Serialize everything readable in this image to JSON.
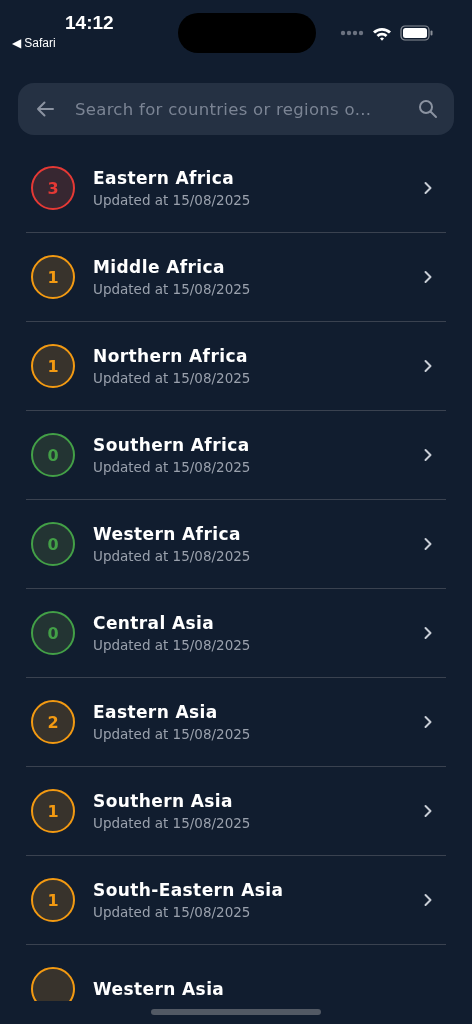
{
  "status_bar": {
    "time": "14:12",
    "back_app": "◀ Safari"
  },
  "search": {
    "placeholder": "Search for countries or regions o..."
  },
  "regions": [
    {
      "name": "Eastern Africa",
      "updated": "Updated at 15/08/2025",
      "count": "3",
      "color": "#e53935"
    },
    {
      "name": "Middle Africa",
      "updated": "Updated at 15/08/2025",
      "count": "1",
      "color": "#f39a12"
    },
    {
      "name": "Northern Africa",
      "updated": "Updated at 15/08/2025",
      "count": "1",
      "color": "#f39a12"
    },
    {
      "name": "Southern Africa",
      "updated": "Updated at 15/08/2025",
      "count": "0",
      "color": "#43a047"
    },
    {
      "name": "Western Africa",
      "updated": "Updated at 15/08/2025",
      "count": "0",
      "color": "#43a047"
    },
    {
      "name": "Central Asia",
      "updated": "Updated at 15/08/2025",
      "count": "0",
      "color": "#43a047"
    },
    {
      "name": "Eastern Asia",
      "updated": "Updated at 15/08/2025",
      "count": "2",
      "color": "#f39a12"
    },
    {
      "name": "Southern Asia",
      "updated": "Updated at 15/08/2025",
      "count": "1",
      "color": "#f39a12"
    },
    {
      "name": "South-Eastern Asia",
      "updated": "Updated at 15/08/2025",
      "count": "1",
      "color": "#f39a12"
    },
    {
      "name": "Western Asia",
      "color": "#f39a12"
    }
  ]
}
